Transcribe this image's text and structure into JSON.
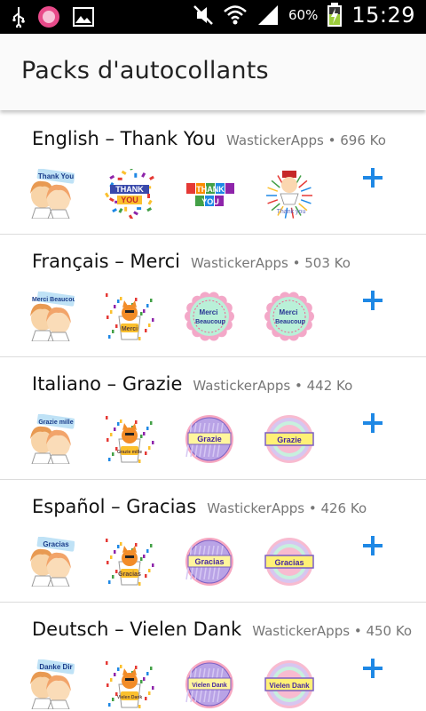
{
  "status_bar": {
    "battery_percent": "60%",
    "time": "15:29",
    "icons": [
      "usb-icon",
      "app-notification-icon",
      "image-icon",
      "mute-icon",
      "wifi-icon",
      "signal-icon",
      "battery-charging-icon"
    ]
  },
  "app_bar": {
    "title": "Packs d'autocollants"
  },
  "packs": [
    {
      "name": "English – Thank You",
      "publisher": "WastickerApps",
      "size": "696 Ko",
      "stickers": [
        {
          "label": "Thank You",
          "kind": "couple"
        },
        {
          "label": "THANK YOU",
          "kind": "text-confetti"
        },
        {
          "label": "THANK YOU",
          "kind": "text-blocks"
        },
        {
          "label": "Thank you",
          "kind": "character"
        }
      ]
    },
    {
      "name": "Français – Merci",
      "publisher": "WastickerApps",
      "size": "503 Ko",
      "stickers": [
        {
          "label": "Merci Beaucoup",
          "kind": "couple"
        },
        {
          "label": "Merci",
          "kind": "cat-cup"
        },
        {
          "label": "Merci Beaucoup",
          "kind": "flower-badge"
        },
        {
          "label": "Merci Beaucoup",
          "kind": "flower-badge"
        }
      ]
    },
    {
      "name": "Italiano – Grazie",
      "publisher": "WastickerApps",
      "size": "442 Ko",
      "stickers": [
        {
          "label": "Grazie mille",
          "kind": "couple"
        },
        {
          "label": "Grazie mille",
          "kind": "cat-cup"
        },
        {
          "label": "Grazie",
          "kind": "round-badge"
        },
        {
          "label": "Grazie",
          "kind": "ring-badge"
        }
      ]
    },
    {
      "name": "Español – Gracias",
      "publisher": "WastickerApps",
      "size": "426 Ko",
      "stickers": [
        {
          "label": "Gracias",
          "kind": "couple"
        },
        {
          "label": "Gracias",
          "kind": "cat-cup"
        },
        {
          "label": "Gracias",
          "kind": "round-badge"
        },
        {
          "label": "Gracias",
          "kind": "ring-badge"
        }
      ]
    },
    {
      "name": "Deutsch – Vielen Dank",
      "publisher": "WastickerApps",
      "size": "450 Ko",
      "stickers": [
        {
          "label": "Danke Dir",
          "kind": "couple"
        },
        {
          "label": "Vielen Dank",
          "kind": "cat-cup"
        },
        {
          "label": "Vielen Dank",
          "kind": "round-badge"
        },
        {
          "label": "Vielen Dank",
          "kind": "ring-badge"
        }
      ]
    }
  ],
  "add_icon": "plus-icon",
  "colors": {
    "accent": "#1e88e5",
    "status_bar": "#000000",
    "app_bar": "#fafafa"
  }
}
